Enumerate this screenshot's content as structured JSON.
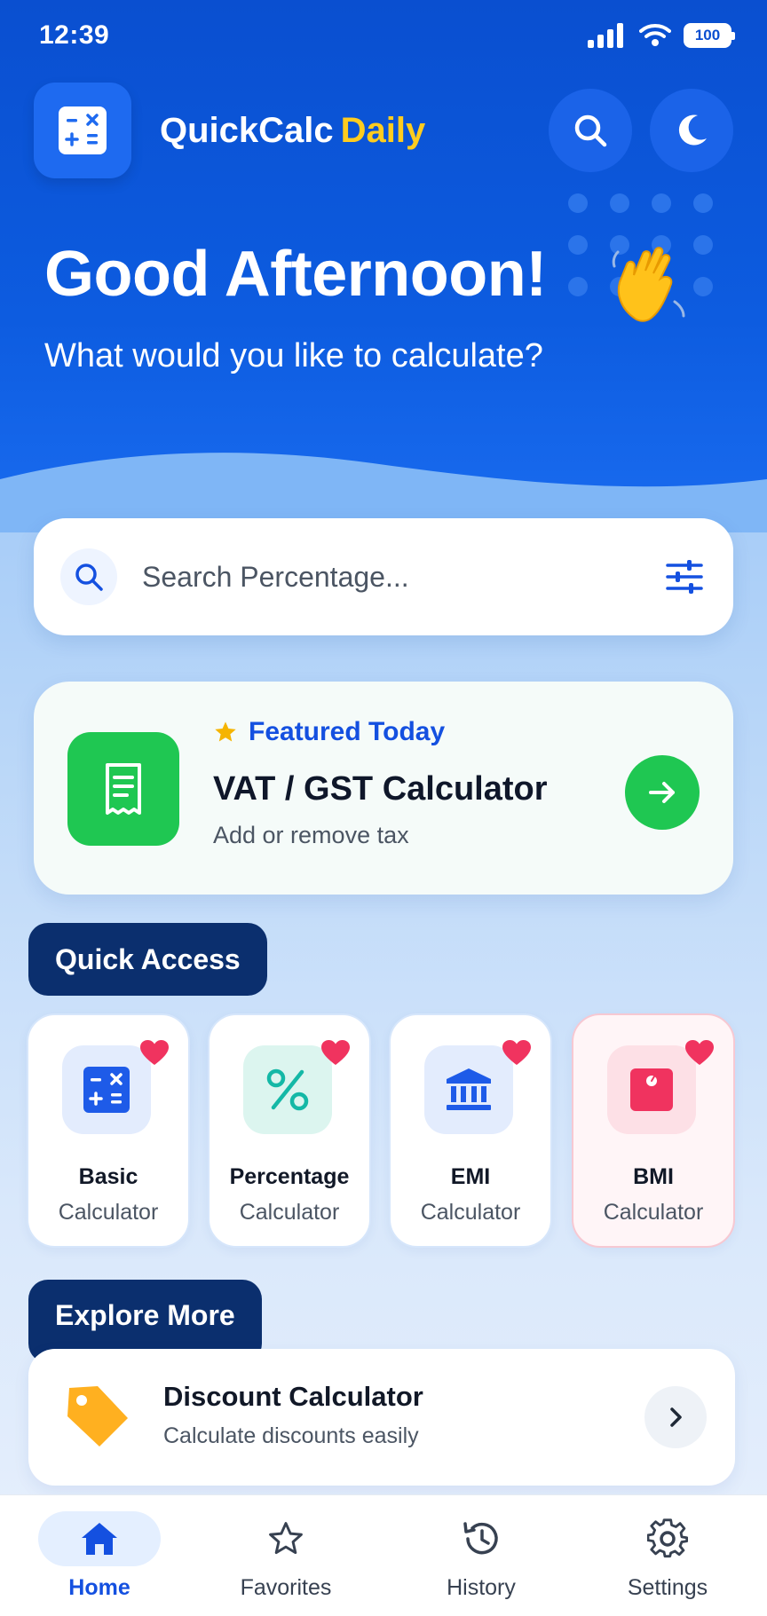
{
  "status_bar": {
    "time": "12:39",
    "battery": "100"
  },
  "app": {
    "title_main": "QuickCalc",
    "title_accent": "Daily"
  },
  "greeting": {
    "title": "Good Afternoon!",
    "subtitle": "What would you like to calculate?"
  },
  "search": {
    "placeholder": "Search Percentage..."
  },
  "featured": {
    "label": "Featured Today",
    "title": "VAT / GST Calculator",
    "subtitle": "Add or remove tax"
  },
  "quick_access": {
    "heading": "Quick Access",
    "items": [
      {
        "title": "Basic",
        "subtitle": "Calculator",
        "icon": "calculator-icon",
        "color": "#1e5be8",
        "favorite": true
      },
      {
        "title": "Percentage",
        "subtitle": "Calculator",
        "icon": "percent-icon",
        "color": "#14b8a6",
        "favorite": true
      },
      {
        "title": "EMI",
        "subtitle": "Calculator",
        "icon": "bank-icon",
        "color": "#1e5be8",
        "favorite": true
      },
      {
        "title": "BMI",
        "subtitle": "Calculator",
        "icon": "scale-icon",
        "color": "#f0335f",
        "favorite": true
      }
    ]
  },
  "explore": {
    "heading": "Explore More",
    "items": [
      {
        "title": "Discount Calculator",
        "subtitle": "Calculate discounts easily",
        "icon": "tag-icon"
      }
    ]
  },
  "nav": {
    "items": [
      {
        "label": "Home",
        "icon": "home-icon",
        "active": true
      },
      {
        "label": "Favorites",
        "icon": "star-icon",
        "active": false
      },
      {
        "label": "History",
        "icon": "history-icon",
        "active": false
      },
      {
        "label": "Settings",
        "icon": "gear-icon",
        "active": false
      }
    ]
  },
  "colors": {
    "primary": "#0d5ce0",
    "accent_yellow": "#ffcc1f",
    "green": "#1fc752",
    "navy": "#0b2f6e",
    "heart": "#f0335f"
  }
}
